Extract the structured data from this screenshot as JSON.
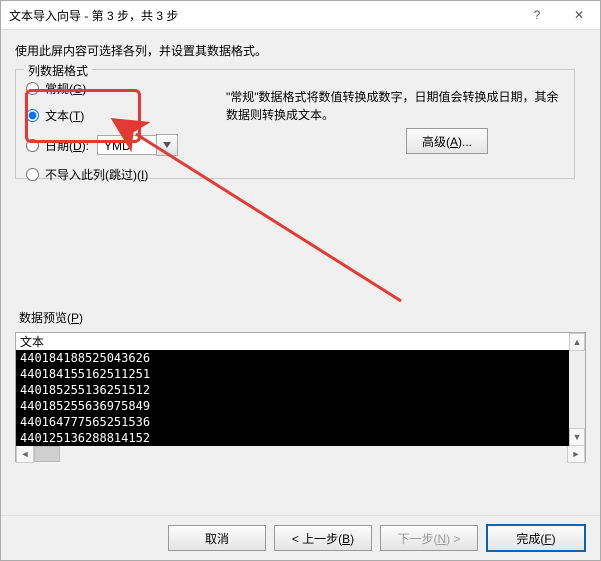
{
  "title": "文本导入向导 - 第 3 步，共 3 步",
  "instruction": "使用此屏内容可选择各列，并设置其数据格式。",
  "fieldset": {
    "legend": "列数据格式",
    "general_label": "常规",
    "general_hot": "G",
    "text_label": "文本",
    "text_hot": "T",
    "date_label": "日期",
    "date_hot": "D",
    "date_value": "YMD",
    "skip_label": "不导入此列(跳过)",
    "skip_hot": "I",
    "right_text": "\"常规\"数据格式将数值转换成数字，日期值会转换成日期，其余数据则转换成文本。",
    "advanced_label": "高级",
    "advanced_hot": "A",
    "advanced_suffix": "..."
  },
  "preview": {
    "label": "数据预览",
    "label_hot": "P",
    "header": "文本",
    "rows": [
      "440184188525043626",
      "440184155162511251",
      "440185255136251512",
      "440185255636975849",
      "440164777565251536",
      "440125136288814152"
    ]
  },
  "buttons": {
    "cancel": "取消",
    "back": "< 上一步",
    "back_hot": "B",
    "next": "下一步",
    "next_hot": "N",
    "next_suffix": " >",
    "finish": "完成",
    "finish_hot": "F"
  }
}
